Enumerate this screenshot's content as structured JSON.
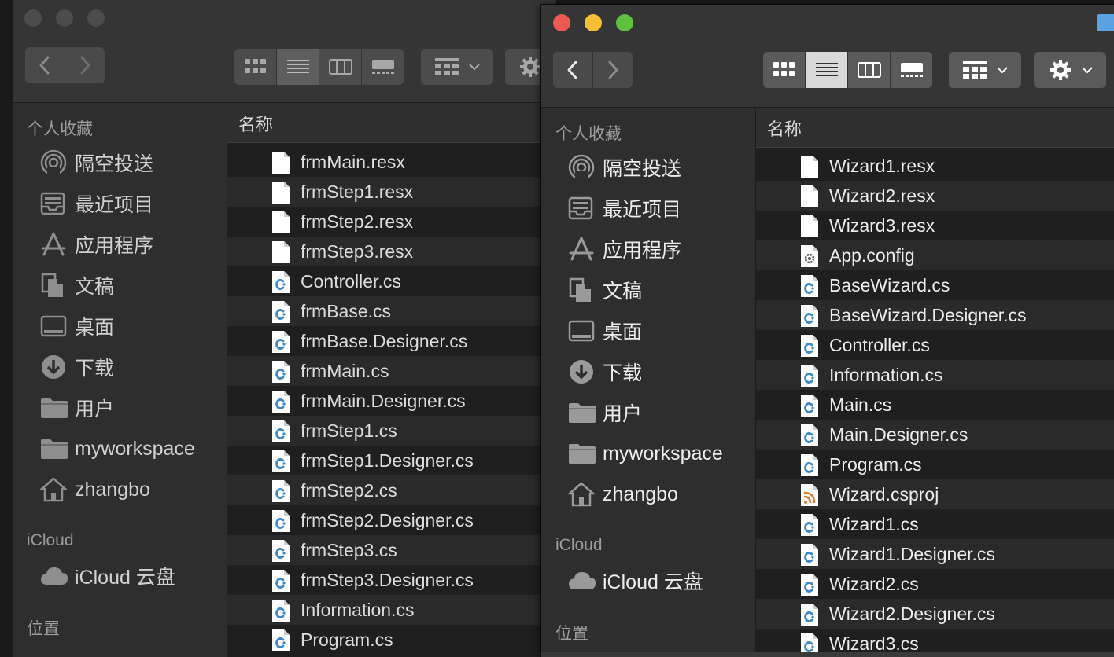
{
  "left_window": {
    "sidebar": {
      "favorites_title": "个人收藏",
      "items": [
        {
          "label": "隔空投送",
          "icon": "airdrop-icon"
        },
        {
          "label": "最近项目",
          "icon": "recents-icon"
        },
        {
          "label": "应用程序",
          "icon": "applications-icon"
        },
        {
          "label": "文稿",
          "icon": "documents-icon"
        },
        {
          "label": "桌面",
          "icon": "desktop-icon"
        },
        {
          "label": "下载",
          "icon": "downloads-icon"
        },
        {
          "label": "用户",
          "icon": "folder-icon"
        },
        {
          "label": "myworkspace",
          "icon": "folder-icon"
        },
        {
          "label": "zhangbo",
          "icon": "home-icon"
        }
      ],
      "icloud_title": "iCloud",
      "icloud_item": {
        "label": "iCloud 云盘",
        "icon": "cloud-icon"
      },
      "locations_title": "位置"
    },
    "column_header": "名称",
    "files": [
      {
        "name": "frmMain.resx",
        "type": "doc"
      },
      {
        "name": "frmStep1.resx",
        "type": "doc"
      },
      {
        "name": "frmStep2.resx",
        "type": "doc"
      },
      {
        "name": "frmStep3.resx",
        "type": "doc"
      },
      {
        "name": "Controller.cs",
        "type": "cs"
      },
      {
        "name": "frmBase.cs",
        "type": "cs"
      },
      {
        "name": "frmBase.Designer.cs",
        "type": "cs"
      },
      {
        "name": "frmMain.cs",
        "type": "cs"
      },
      {
        "name": "frmMain.Designer.cs",
        "type": "cs"
      },
      {
        "name": "frmStep1.cs",
        "type": "cs"
      },
      {
        "name": "frmStep1.Designer.cs",
        "type": "cs"
      },
      {
        "name": "frmStep2.cs",
        "type": "cs"
      },
      {
        "name": "frmStep2.Designer.cs",
        "type": "cs"
      },
      {
        "name": "frmStep3.cs",
        "type": "cs"
      },
      {
        "name": "frmStep3.Designer.cs",
        "type": "cs"
      },
      {
        "name": "Information.cs",
        "type": "cs"
      },
      {
        "name": "Program.cs",
        "type": "cs"
      }
    ]
  },
  "right_window": {
    "sidebar": {
      "favorites_title": "个人收藏",
      "items": [
        {
          "label": "隔空投送",
          "icon": "airdrop-icon"
        },
        {
          "label": "最近项目",
          "icon": "recents-icon"
        },
        {
          "label": "应用程序",
          "icon": "applications-icon"
        },
        {
          "label": "文稿",
          "icon": "documents-icon"
        },
        {
          "label": "桌面",
          "icon": "desktop-icon"
        },
        {
          "label": "下载",
          "icon": "downloads-icon"
        },
        {
          "label": "用户",
          "icon": "folder-icon"
        },
        {
          "label": "myworkspace",
          "icon": "folder-icon"
        },
        {
          "label": "zhangbo",
          "icon": "home-icon"
        }
      ],
      "icloud_title": "iCloud",
      "icloud_item": {
        "label": "iCloud 云盘",
        "icon": "cloud-icon"
      },
      "locations_title": "位置"
    },
    "column_header": "名称",
    "files": [
      {
        "name": "Wizard1.resx",
        "type": "doc"
      },
      {
        "name": "Wizard2.resx",
        "type": "doc"
      },
      {
        "name": "Wizard3.resx",
        "type": "doc"
      },
      {
        "name": "App.config",
        "type": "config"
      },
      {
        "name": "BaseWizard.cs",
        "type": "cs"
      },
      {
        "name": "BaseWizard.Designer.cs",
        "type": "cs"
      },
      {
        "name": "Controller.cs",
        "type": "cs"
      },
      {
        "name": "Information.cs",
        "type": "cs"
      },
      {
        "name": "Main.cs",
        "type": "cs"
      },
      {
        "name": "Main.Designer.cs",
        "type": "cs"
      },
      {
        "name": "Program.cs",
        "type": "cs"
      },
      {
        "name": "Wizard.csproj",
        "type": "csproj"
      },
      {
        "name": "Wizard1.cs",
        "type": "cs"
      },
      {
        "name": "Wizard1.Designer.cs",
        "type": "cs"
      },
      {
        "name": "Wizard2.cs",
        "type": "cs"
      },
      {
        "name": "Wizard2.Designer.cs",
        "type": "cs"
      },
      {
        "name": "Wizard3.cs",
        "type": "cs"
      }
    ]
  },
  "colors": {
    "accent_cs": "#3f88c5",
    "rss_orange": "#e07a2f"
  }
}
